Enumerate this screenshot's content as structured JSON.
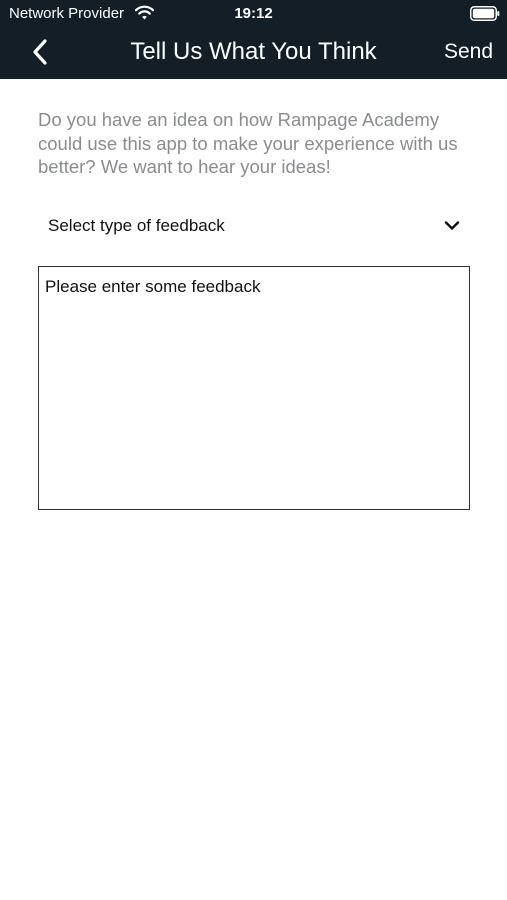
{
  "status_bar": {
    "carrier": "Network Provider",
    "time": "19:12",
    "wifi_icon": "wifi-icon",
    "battery_icon": "battery-icon"
  },
  "nav": {
    "back_icon": "chevron-left-icon",
    "title": "Tell Us What You Think",
    "send_label": "Send"
  },
  "intro_text": "Do you have an idea on how Rampage Academy could use this app to make your experience with us better? We want to hear your ideas!",
  "feedback_type": {
    "label": "Select type of feedback",
    "icon": "chevron-down-icon"
  },
  "feedback": {
    "value": "",
    "placeholder": "Please enter some feedback"
  },
  "colors": {
    "header_background": "#141e26",
    "header_text": "#ffffff",
    "intro_text": "#8a8d90",
    "body_text": "#111111",
    "border": "#333333"
  }
}
